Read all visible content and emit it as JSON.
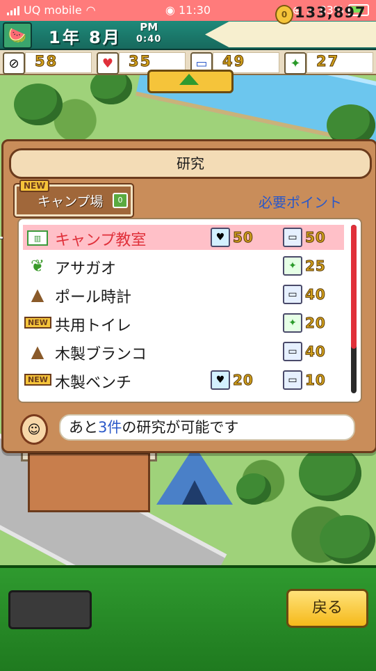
{
  "status_bar": {
    "carrier": "UQ mobile",
    "time": "11:30",
    "battery": "83%"
  },
  "hud": {
    "date": "1年 8月",
    "ampm": "PM",
    "clock": "0:40",
    "money": "133,897",
    "coin_symbol": "0"
  },
  "stats": [
    {
      "icon": "compass-icon",
      "value": "58"
    },
    {
      "icon": "lightbulb-icon",
      "value": "35"
    },
    {
      "icon": "book-icon",
      "value": "49"
    },
    {
      "icon": "sparkle-icon",
      "value": "27"
    }
  ],
  "dialog": {
    "title": "研究",
    "category": {
      "new_badge": "NEW",
      "label": "キャンプ場",
      "icon": "0"
    },
    "required_points_label": "必要ポイント",
    "items": [
      {
        "name": "キャンプ教室",
        "icon": "camp-icon",
        "new": "",
        "bulb": "50",
        "book": "50",
        "spark": "",
        "selected": true
      },
      {
        "name": "アサガオ",
        "icon": "leaf-icon",
        "new": "",
        "bulb": "",
        "book": "",
        "spark": "25"
      },
      {
        "name": "ポール時計",
        "icon": "stone-icon",
        "new": "",
        "bulb": "",
        "book": "40",
        "spark": ""
      },
      {
        "name": "共用トイレ",
        "icon": "new-icon",
        "new": "NEW",
        "bulb": "",
        "book": "",
        "spark": "20"
      },
      {
        "name": "木製ブランコ",
        "icon": "stone-icon",
        "new": "",
        "bulb": "",
        "book": "40",
        "spark": ""
      },
      {
        "name": "木製ベンチ",
        "icon": "new-icon",
        "new": "NEW",
        "bulb": "20",
        "book": "10",
        "spark": ""
      }
    ],
    "hint": {
      "prefix": "あと",
      "count": "3件",
      "suffix": "の研究が可能です"
    }
  },
  "bottom": {
    "back_label": "戻る"
  }
}
